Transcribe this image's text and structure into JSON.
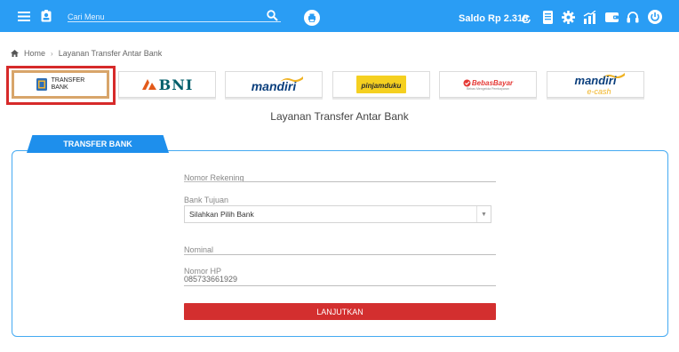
{
  "header": {
    "search_placeholder": "Cari Menu",
    "saldo": "Saldo Rp 2.318",
    "icons": [
      "menu-icon",
      "contact-card-icon",
      "search-icon",
      "print-icon",
      "refresh-icon",
      "document-icon",
      "gear-icon",
      "chart-icon",
      "wallet-icon",
      "headset-icon",
      "power-icon"
    ]
  },
  "breadcrumb": {
    "home": "Home",
    "current": "Layanan Transfer Antar Bank"
  },
  "banks": [
    {
      "name": "TRANSFER BANK",
      "line1": "TRANSFER",
      "line2": "BANK",
      "selected": true
    },
    {
      "name": "BNI",
      "text": "BNI"
    },
    {
      "name": "mandiri",
      "text": "mandiri"
    },
    {
      "name": "pinjamduku",
      "text": "pinjamduku"
    },
    {
      "name": "BebasBayar",
      "text": "BebasBayar",
      "sub": "Bebas Mengelola Pembayaran"
    },
    {
      "name": "mandiri e-cash",
      "text": "mandiri",
      "sub": "e-cash"
    }
  ],
  "page_title": "Layanan Transfer Antar Bank",
  "tab_label": "TRANSFER BANK",
  "form": {
    "nomor_rekening_label": "Nomor Rekening",
    "bank_tujuan_label": "Bank Tujuan",
    "bank_tujuan_value": "Silahkan Pilih Bank",
    "nominal_label": "Nominal",
    "nomor_hp_label": "Nomor HP",
    "nomor_hp_value": "085733661929",
    "submit_label": "LANJUTKAN"
  },
  "colors": {
    "topbar": "#2a9df4",
    "tab": "#1e8fec",
    "panel_border": "#45aaf2",
    "submit": "#d32f2f",
    "selection": "#d62a2a"
  }
}
